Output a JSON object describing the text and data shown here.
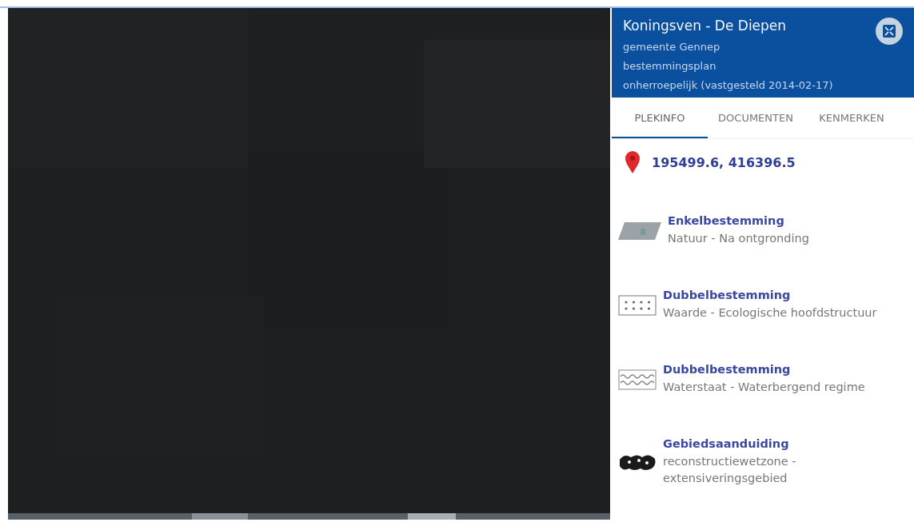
{
  "panel": {
    "title": "Koningsven - De Diepen",
    "lines": [
      "gemeente Gennep",
      "bestemmingsplan",
      "onherroepelijk (vastgesteld 2014-02-17)"
    ]
  },
  "tabs": [
    {
      "label": "PLEKINFO",
      "selected": true
    },
    {
      "label": "DOCUMENTEN",
      "selected": false
    },
    {
      "label": "KENMERKEN",
      "selected": false
    }
  ],
  "location": {
    "coordinates": "195499.6, 416396.5"
  },
  "items": [
    {
      "kind": "area",
      "title": "Enkelbestemming",
      "description": "Natuur - Na ontgronding"
    },
    {
      "kind": "dots",
      "title": "Dubbelbestemming",
      "description": "Waarde - Ecologische hoofdstructuur"
    },
    {
      "kind": "waves",
      "title": "Dubbelbestemming",
      "description": "Waterstaat - Waterbergend regime"
    },
    {
      "kind": "zone",
      "title": "Gebiedsaanduiding",
      "description": "reconstructiewetzone - extensiveringsgebied"
    }
  ]
}
